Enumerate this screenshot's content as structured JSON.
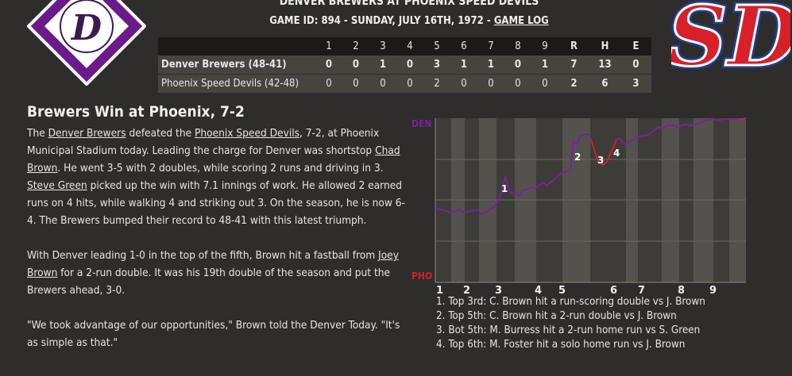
{
  "header": {
    "matchup": "DENVER BREWERS AT PHOENIX SPEED DEVILS",
    "game_info_prefix": "GAME ID: 894 - SUNDAY, JULY 16TH, 1972 - ",
    "game_log_link": "GAME LOG"
  },
  "logos": {
    "home_team_logo_text": "SD",
    "away_team_logo_text": "D",
    "away_color": "#6a1b8a",
    "home_red": "#d7202a",
    "home_blue": "#1d3f94"
  },
  "linescore": {
    "columns": [
      "1",
      "2",
      "3",
      "4",
      "5",
      "6",
      "7",
      "8",
      "9",
      "R",
      "H",
      "E"
    ],
    "rows": [
      {
        "team": "Denver Brewers (48-41)",
        "values": [
          "0",
          "0",
          "1",
          "0",
          "3",
          "1",
          "1",
          "0",
          "1",
          "7",
          "13",
          "0"
        ]
      },
      {
        "team": "Phoenix Speed Devils (42-48)",
        "values": [
          "0",
          "0",
          "0",
          "0",
          "2",
          "0",
          "0",
          "0",
          "0",
          "2",
          "6",
          "3"
        ]
      }
    ]
  },
  "article": {
    "headline": "Brewers Win at Phoenix, 7-2",
    "p1_t1": "The ",
    "p1_l1": "Denver Brewers",
    "p1_t2": " defeated the ",
    "p1_l2": "Phoenix Speed Devils",
    "p1_t3": ", 7-2, at Phoenix Municipal Stadium today. Leading the charge for Denver was shortstop ",
    "p1_l3": "Chad Brown",
    "p1_t4": ". He went 3-5 with 2 doubles, while scoring 2 runs and driving in 3. ",
    "p1_l4": "Steve Green",
    "p1_t5": " picked up the win with 7.1 innings of work. He allowed 2 earned runs on 4 hits, while walking 4 and striking out 3. On the season, he is now 6-4. The Brewers bumped their record to 48-41 with this latest triumph.",
    "p2_t1": "With Denver leading 1-0 in the top of the fifth, Brown hit a fastball from ",
    "p2_l1": "Joey Brown",
    "p2_t2": " for a 2-run double. It was his 19th double of the season and put the Brewers ahead, 3-0.",
    "p3": "\"We took advantage of our opportunities,\" Brown told the Denver Today. \"It's as simple as that.\""
  },
  "wp_chart": {
    "top_label": "DEN",
    "bottom_label": "PHO",
    "innings": [
      "1",
      "2",
      "3",
      "4",
      "5",
      "6",
      "7",
      "8",
      "9"
    ],
    "away_color": "#7b1fa2",
    "home_color": "#d7202a",
    "markers": [
      "1",
      "2",
      "3",
      "4"
    ]
  },
  "key_plays": [
    "1. Top 3rd: C. Brown hit a run-scoring double vs J. Brown",
    "2. Top 5th: C. Brown hit a 2-run double vs J. Brown",
    "3. Bot 5th: M. Burress hit a 2-run home run vs S. Green",
    "4. Top 6th: M. Foster hit a solo home run vs J. Brown"
  ]
}
